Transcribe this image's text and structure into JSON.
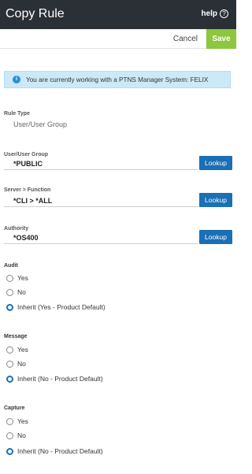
{
  "header": {
    "title": "Copy Rule",
    "help_label": "help",
    "help_icon": "question-circle-icon"
  },
  "actions": {
    "cancel_label": "Cancel",
    "save_label": "Save",
    "save_color": "#8dc63f"
  },
  "info": {
    "icon": "info-icon",
    "text": "You are currently working with a PTNS Manager System: FELIX"
  },
  "rule_type": {
    "label": "Rule Type",
    "value": "User/User Group"
  },
  "user_group": {
    "label": "User/User Group",
    "value": "*PUBLIC",
    "button": "Lookup"
  },
  "server_function": {
    "label": "Server > Function",
    "value": "*CLI > *ALL",
    "button": "Lookup"
  },
  "authority": {
    "label": "Authority",
    "value": "*OS400",
    "button": "Lookup"
  },
  "audit": {
    "label": "Audit",
    "options": [
      "Yes",
      "No",
      "Inherit (Yes - Product Default)"
    ],
    "selected": "Inherit (Yes - Product Default)"
  },
  "message": {
    "label": "Message",
    "options": [
      "Yes",
      "No",
      "Inherit (No - Product Default)"
    ],
    "selected": "Inherit (No - Product Default)"
  },
  "capture": {
    "label": "Capture",
    "options": [
      "Yes",
      "No",
      "Inherit (No - Product Default)"
    ],
    "selected": "Inherit (No - Product Default)"
  },
  "colors": {
    "header_bg": "#2b2f36",
    "accent": "#1a6fb5",
    "info_bg": "#cce9f8"
  }
}
